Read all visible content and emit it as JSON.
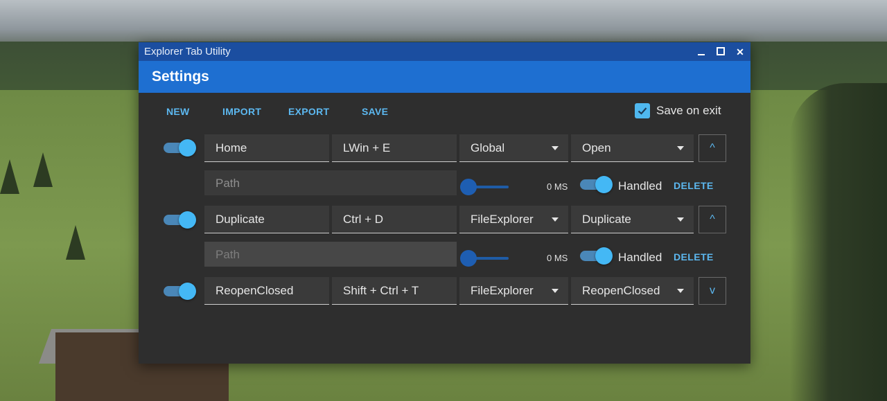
{
  "window": {
    "title": "Explorer Tab Utility"
  },
  "header": {
    "title": "Settings"
  },
  "toolbar": {
    "new_label": "NEW",
    "import_label": "IMPORT",
    "export_label": "EXPORT",
    "save_label": "SAVE",
    "save_on_exit_label": "Save on exit",
    "save_on_exit_checked": true
  },
  "rows": [
    {
      "enabled": true,
      "name": "Home",
      "hotkey": "LWin + E",
      "scope": "Global",
      "action": "Open",
      "path_placeholder": "Path",
      "delay_label": "0 MS",
      "delay_value": 0,
      "handled": true,
      "handled_label": "Handled",
      "delete_label": "DELETE",
      "move_icon": "chevron-up-icon",
      "move_glyph": "^"
    },
    {
      "enabled": true,
      "name": "Duplicate",
      "hotkey": "Ctrl + D",
      "scope": "FileExplorer",
      "action": "Duplicate",
      "path_placeholder": "Path",
      "delay_label": "0 MS",
      "delay_value": 0,
      "handled": true,
      "handled_label": "Handled",
      "delete_label": "DELETE",
      "move_icon": "chevron-up-icon",
      "move_glyph": "^"
    },
    {
      "enabled": true,
      "name": "ReopenClosed",
      "hotkey": "Shift + Ctrl + T",
      "scope": "FileExplorer",
      "action": "ReopenClosed",
      "move_icon": "chevron-down-icon",
      "move_glyph": "v"
    }
  ],
  "colors": {
    "titlebar": "#1b4ea0",
    "header": "#1e6fd1",
    "accent": "#5cb8f0",
    "window_bg": "#2e2e2e"
  }
}
